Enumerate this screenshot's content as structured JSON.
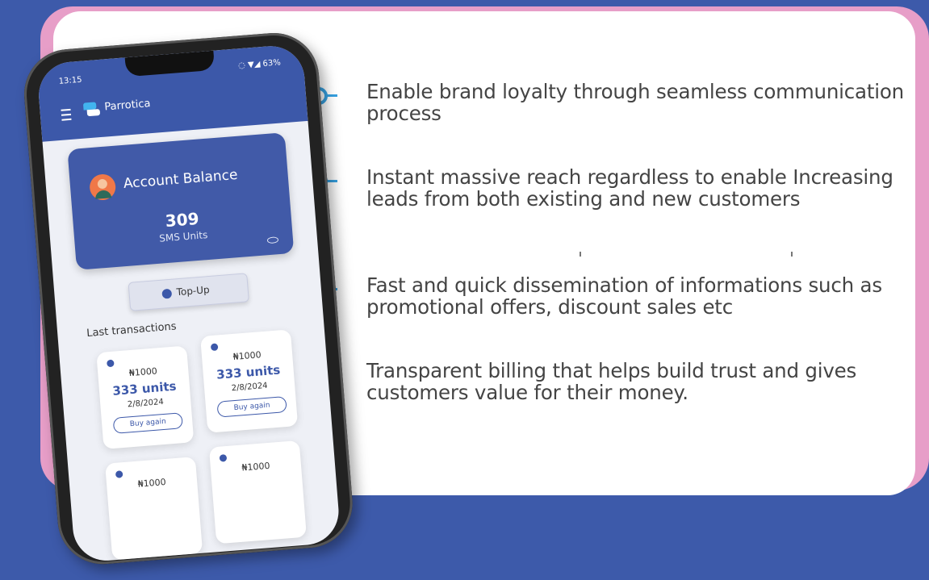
{
  "benefits": [
    {
      "text": "Enable brand loyalty through seamless communication process"
    },
    {
      "text": "Instant massive reach regardless to enable Increasing leads from both existing and new customers"
    },
    {
      "text": "Fast and quick dissemination of informations such as promotional offers, discount sales etc"
    },
    {
      "text": "Transparent billing that helps build trust and gives customers value for their money."
    }
  ],
  "phone": {
    "status_time": "13:15",
    "status_icons": "◌ ▼◢ 63%",
    "app_name": "Parrotica",
    "balance_title": "Account Balance",
    "balance_value": "309",
    "balance_unit": "SMS Units",
    "topup_label": "Top-Up",
    "last_transactions_label": "Last transactions",
    "transactions": [
      {
        "price": "₦1000",
        "units": "333 units",
        "date": "2/8/2024",
        "action": "Buy again"
      },
      {
        "price": "₦1000",
        "units": "333 units",
        "date": "2/8/2024",
        "action": "Buy again"
      },
      {
        "price": "₦1000",
        "units": "",
        "date": "",
        "action": ""
      },
      {
        "price": "₦1000",
        "units": "",
        "date": "",
        "action": ""
      }
    ]
  },
  "colors": {
    "background": "#3d5aaa",
    "frame": "#e79ec8",
    "accent": "#36a0e0",
    "app_primary": "#3c58a9"
  },
  "icons": [
    "bullet-ring-icon",
    "menu-icon",
    "brand-chat-icon",
    "avatar",
    "eye-icon",
    "plus-icon",
    "check-icon"
  ]
}
